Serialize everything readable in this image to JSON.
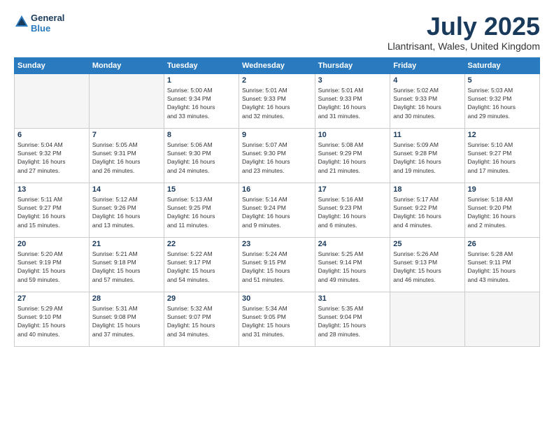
{
  "logo": {
    "line1": "General",
    "line2": "Blue"
  },
  "title": "July 2025",
  "subtitle": "Llantrisant, Wales, United Kingdom",
  "days_of_week": [
    "Sunday",
    "Monday",
    "Tuesday",
    "Wednesday",
    "Thursday",
    "Friday",
    "Saturday"
  ],
  "weeks": [
    [
      {
        "day": "",
        "info": ""
      },
      {
        "day": "",
        "info": ""
      },
      {
        "day": "1",
        "info": "Sunrise: 5:00 AM\nSunset: 9:34 PM\nDaylight: 16 hours\nand 33 minutes."
      },
      {
        "day": "2",
        "info": "Sunrise: 5:01 AM\nSunset: 9:33 PM\nDaylight: 16 hours\nand 32 minutes."
      },
      {
        "day": "3",
        "info": "Sunrise: 5:01 AM\nSunset: 9:33 PM\nDaylight: 16 hours\nand 31 minutes."
      },
      {
        "day": "4",
        "info": "Sunrise: 5:02 AM\nSunset: 9:33 PM\nDaylight: 16 hours\nand 30 minutes."
      },
      {
        "day": "5",
        "info": "Sunrise: 5:03 AM\nSunset: 9:32 PM\nDaylight: 16 hours\nand 29 minutes."
      }
    ],
    [
      {
        "day": "6",
        "info": "Sunrise: 5:04 AM\nSunset: 9:32 PM\nDaylight: 16 hours\nand 27 minutes."
      },
      {
        "day": "7",
        "info": "Sunrise: 5:05 AM\nSunset: 9:31 PM\nDaylight: 16 hours\nand 26 minutes."
      },
      {
        "day": "8",
        "info": "Sunrise: 5:06 AM\nSunset: 9:30 PM\nDaylight: 16 hours\nand 24 minutes."
      },
      {
        "day": "9",
        "info": "Sunrise: 5:07 AM\nSunset: 9:30 PM\nDaylight: 16 hours\nand 23 minutes."
      },
      {
        "day": "10",
        "info": "Sunrise: 5:08 AM\nSunset: 9:29 PM\nDaylight: 16 hours\nand 21 minutes."
      },
      {
        "day": "11",
        "info": "Sunrise: 5:09 AM\nSunset: 9:28 PM\nDaylight: 16 hours\nand 19 minutes."
      },
      {
        "day": "12",
        "info": "Sunrise: 5:10 AM\nSunset: 9:27 PM\nDaylight: 16 hours\nand 17 minutes."
      }
    ],
    [
      {
        "day": "13",
        "info": "Sunrise: 5:11 AM\nSunset: 9:27 PM\nDaylight: 16 hours\nand 15 minutes."
      },
      {
        "day": "14",
        "info": "Sunrise: 5:12 AM\nSunset: 9:26 PM\nDaylight: 16 hours\nand 13 minutes."
      },
      {
        "day": "15",
        "info": "Sunrise: 5:13 AM\nSunset: 9:25 PM\nDaylight: 16 hours\nand 11 minutes."
      },
      {
        "day": "16",
        "info": "Sunrise: 5:14 AM\nSunset: 9:24 PM\nDaylight: 16 hours\nand 9 minutes."
      },
      {
        "day": "17",
        "info": "Sunrise: 5:16 AM\nSunset: 9:23 PM\nDaylight: 16 hours\nand 6 minutes."
      },
      {
        "day": "18",
        "info": "Sunrise: 5:17 AM\nSunset: 9:22 PM\nDaylight: 16 hours\nand 4 minutes."
      },
      {
        "day": "19",
        "info": "Sunrise: 5:18 AM\nSunset: 9:20 PM\nDaylight: 16 hours\nand 2 minutes."
      }
    ],
    [
      {
        "day": "20",
        "info": "Sunrise: 5:20 AM\nSunset: 9:19 PM\nDaylight: 15 hours\nand 59 minutes."
      },
      {
        "day": "21",
        "info": "Sunrise: 5:21 AM\nSunset: 9:18 PM\nDaylight: 15 hours\nand 57 minutes."
      },
      {
        "day": "22",
        "info": "Sunrise: 5:22 AM\nSunset: 9:17 PM\nDaylight: 15 hours\nand 54 minutes."
      },
      {
        "day": "23",
        "info": "Sunrise: 5:24 AM\nSunset: 9:15 PM\nDaylight: 15 hours\nand 51 minutes."
      },
      {
        "day": "24",
        "info": "Sunrise: 5:25 AM\nSunset: 9:14 PM\nDaylight: 15 hours\nand 49 minutes."
      },
      {
        "day": "25",
        "info": "Sunrise: 5:26 AM\nSunset: 9:13 PM\nDaylight: 15 hours\nand 46 minutes."
      },
      {
        "day": "26",
        "info": "Sunrise: 5:28 AM\nSunset: 9:11 PM\nDaylight: 15 hours\nand 43 minutes."
      }
    ],
    [
      {
        "day": "27",
        "info": "Sunrise: 5:29 AM\nSunset: 9:10 PM\nDaylight: 15 hours\nand 40 minutes."
      },
      {
        "day": "28",
        "info": "Sunrise: 5:31 AM\nSunset: 9:08 PM\nDaylight: 15 hours\nand 37 minutes."
      },
      {
        "day": "29",
        "info": "Sunrise: 5:32 AM\nSunset: 9:07 PM\nDaylight: 15 hours\nand 34 minutes."
      },
      {
        "day": "30",
        "info": "Sunrise: 5:34 AM\nSunset: 9:05 PM\nDaylight: 15 hours\nand 31 minutes."
      },
      {
        "day": "31",
        "info": "Sunrise: 5:35 AM\nSunset: 9:04 PM\nDaylight: 15 hours\nand 28 minutes."
      },
      {
        "day": "",
        "info": ""
      },
      {
        "day": "",
        "info": ""
      }
    ]
  ]
}
